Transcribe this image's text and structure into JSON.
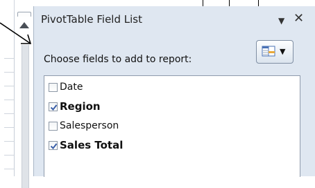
{
  "pane": {
    "title": "PivotTable Field List",
    "menu_glyph": "▼",
    "close_glyph": "✕",
    "prompt": "Choose fields to add to report:",
    "layout_caret": "▼"
  },
  "fields": [
    {
      "label": "Date",
      "checked": false,
      "bold": false
    },
    {
      "label": "Region",
      "checked": true,
      "bold": true
    },
    {
      "label": "Salesperson",
      "checked": false,
      "bold": false
    },
    {
      "label": "Sales Total",
      "checked": true,
      "bold": true
    }
  ],
  "colors": {
    "pane_background": "#dfe7f1",
    "check_mark": "#3a5fa8"
  }
}
